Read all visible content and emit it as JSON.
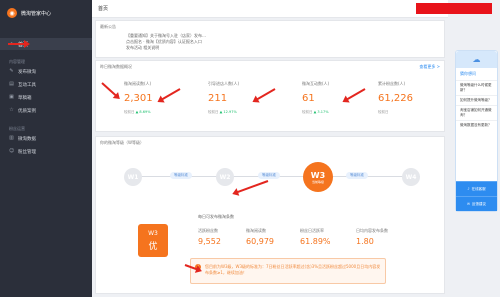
{
  "brand": {
    "name": "微淘管家中心"
  },
  "sidebar": {
    "home": "首页",
    "section1": "内容管理",
    "items": [
      {
        "label": "发布微淘",
        "icon": "edit-icon"
      },
      {
        "label": "互动工具",
        "icon": "tool-icon"
      },
      {
        "label": "草稿箱",
        "icon": "draft-icon"
      },
      {
        "label": "优质案例",
        "icon": "star-icon"
      }
    ],
    "section2": "粉丝运营",
    "items2": [
      {
        "label": "微淘数据",
        "icon": "chart-icon"
      },
      {
        "label": "粉丝管理",
        "icon": "fans-icon"
      }
    ]
  },
  "topbar": {
    "title": "首页"
  },
  "notice": {
    "title": "最新公告",
    "lines": [
      "【重要通知】关于微淘号入驻（店家）发布…",
      "点击报名 · 微淘【优质内容】认证报名入口",
      "发布活动  相关说明"
    ]
  },
  "stats": {
    "title": "昨日微淘数据概况",
    "more": "查看更多 >",
    "cards": [
      {
        "label": "微淘阅读数(人)",
        "value": "2,301",
        "sub": "较前日",
        "change": "▲ 8.69%"
      },
      {
        "label": "引导进店人数(人)",
        "value": "211",
        "sub": "较前日",
        "change": "▲ 12.97%"
      },
      {
        "label": "微淘互动数(人)",
        "value": "61",
        "sub": "较前日",
        "change": "▲ 3.17%"
      },
      {
        "label": "累计粉丝数(人)",
        "value": "61,226",
        "sub": "较前日",
        "change": ""
      }
    ]
  },
  "level": {
    "title": "你的微淘等级（W等级）",
    "nodes": [
      "W1",
      "W2",
      "W3",
      "W4"
    ],
    "active_sub": "当前等级",
    "pills": [
      "等级标准",
      "等级标准",
      "等级标准",
      "等级标准"
    ],
    "badge_level": "W3",
    "badge_grade": "优",
    "result_head": "每日可发布微淘条数",
    "results": [
      {
        "label": "活跃粉丝数",
        "value": "9,552"
      },
      {
        "label": "微淘阅读数",
        "value": "60,979"
      },
      {
        "label": "粉丝日活跃率",
        "value": "61.89%"
      },
      {
        "label": "日均内容发布条数",
        "value": "1.80"
      }
    ],
    "tip": "您目前为W3级，W3级的标准为：7日粉丝日活跃率超过(含)3%且活跃粉丝超过5000且日均内容发布条数≥1，继续加油！"
  },
  "widget": {
    "title": "猜你想问",
    "faqs": [
      "微淘等级什么时候更新？",
      "如何提升微淘等级？",
      "淘宝店铺如何开通微淘？",
      "微淘数据没有更新？"
    ],
    "buttons": [
      "在线客服",
      "反馈建议"
    ]
  },
  "colors": {
    "accent": "#f5741e",
    "link": "#2d8cf0",
    "sidebar": "#2b2f3a",
    "alert": "#e8131a"
  }
}
